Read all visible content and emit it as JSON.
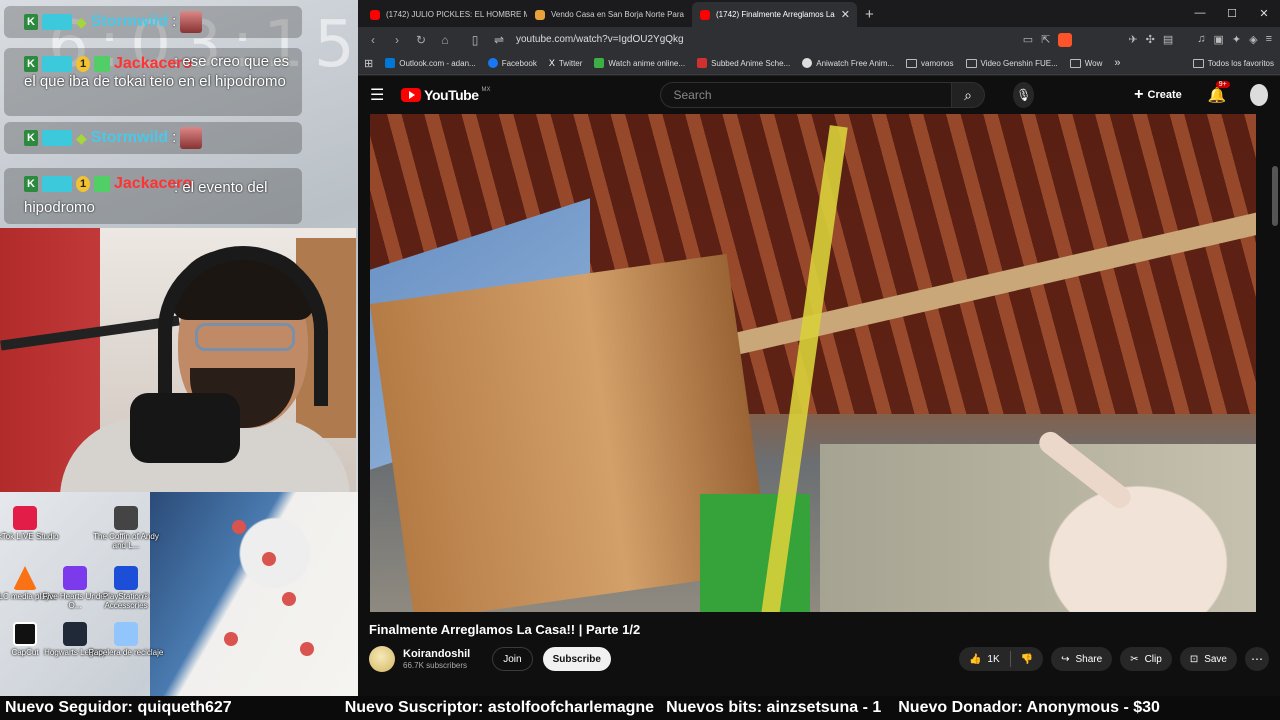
{
  "overlay": {
    "clock": "6:03:15",
    "chat": [
      {
        "user": "Stormwild",
        "color": "cyan",
        "text": ":"
      },
      {
        "user": "Jackacero",
        "color": "red",
        "text": ": ese creo que es el que iba de tokai teio en el hipodromo"
      },
      {
        "user": "Stormwild",
        "color": "cyan",
        "text": ":"
      },
      {
        "user": "Jackacero",
        "color": "red",
        "text": ": el evento del hipodromo"
      }
    ],
    "desktop_icons": [
      {
        "label": "TikTok LIVE Studio",
        "icon": "tiktok-icon"
      },
      {
        "label": "The Coffin of Andy and L...",
        "icon": "game-icon"
      },
      {
        "label": "VLC media player",
        "icon": "vlc-icon"
      },
      {
        "label": "Five Hearts Under O...",
        "icon": "game-icon"
      },
      {
        "label": "PlayStation® Accessories",
        "icon": "playstation-icon"
      },
      {
        "label": "CapCut",
        "icon": "capcut-icon"
      },
      {
        "label": "Hogwarts Legacy",
        "icon": "hogwarts-icon"
      },
      {
        "label": "Papelera de reciclaje",
        "icon": "recycle-bin-icon"
      }
    ]
  },
  "browser": {
    "tabs": [
      {
        "title": "(1742) JULIO PICKLES: EL HOMBRE M",
        "favicon_color": "#ff0000",
        "active": false
      },
      {
        "title": "Vendo Casa en San Borja Norte Para",
        "favicon_color": "#e8a33a",
        "active": false
      },
      {
        "title": "(1742) Finalmente Arreglamos La",
        "favicon_color": "#ff0000",
        "active": true
      }
    ],
    "url": "youtube.com/watch?v=IgdOU2YgQkg",
    "bookmarks": [
      {
        "label": "Outlook.com - adan...",
        "color": "#0078d4"
      },
      {
        "label": "Facebook",
        "color": "#1877f2"
      },
      {
        "label": "Twitter",
        "color": "#222222"
      },
      {
        "label": "Watch anime online...",
        "color": "#3cb043"
      },
      {
        "label": "Subbed Anime Sche...",
        "color": "#d13030"
      },
      {
        "label": "Aniwatch Free Anim...",
        "color": "#dddddd"
      },
      {
        "label": "vamonos",
        "color": "folder"
      },
      {
        "label": "Video Genshin FUE...",
        "color": "folder"
      },
      {
        "label": "Wow",
        "color": "folder"
      }
    ],
    "all_favorites": "Todos los favoritos"
  },
  "youtube": {
    "logo": "YouTube",
    "region": "MX",
    "search_placeholder": "Search",
    "create_label": "Create",
    "notifications": "9+",
    "video_title": "Finalmente Arreglamos La Casa!! | Parte 1/2",
    "channel_name": "Koirandoshil",
    "subscribers": "66.7K subscribers",
    "join_label": "Join",
    "subscribe_label": "Subscribe",
    "likes": "1K",
    "share_label": "Share",
    "clip_label": "Clip",
    "save_label": "Save"
  },
  "ticker": [
    "Nuevo Seguidor: quiqueth627",
    "Nuevo Suscriptor: astolfoofcharlemagne",
    "Nuevos bits: ainzsetsuna - 1",
    "Nuevo Donador: Anonymous - $30"
  ]
}
